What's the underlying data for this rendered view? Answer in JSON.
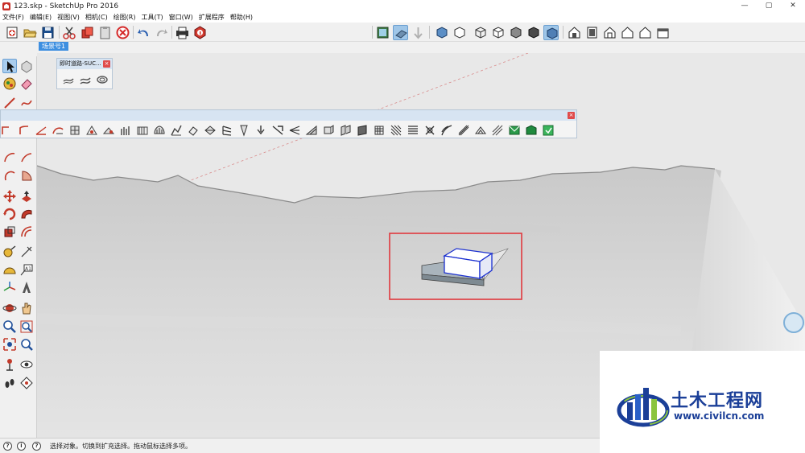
{
  "window": {
    "title": "123.skp - SketchUp Pro 2016",
    "minimize": "—",
    "maximize": "▢",
    "close": "✕"
  },
  "menu": [
    {
      "label": "文件(F)"
    },
    {
      "label": "编辑(E)"
    },
    {
      "label": "视图(V)"
    },
    {
      "label": "相机(C)"
    },
    {
      "label": "绘图(R)"
    },
    {
      "label": "工具(T)"
    },
    {
      "label": "窗口(W)"
    },
    {
      "label": "扩展程序"
    },
    {
      "label": "帮助(H)"
    }
  ],
  "scene": {
    "tab_label": "场景号1"
  },
  "floating_toolbars": {
    "roads": {
      "title": "即时道路-SUC...",
      "close": "×"
    },
    "long": {
      "close": "×"
    }
  },
  "status": {
    "text": "选择对象。切换到扩充选择。拖动鼠标选择多项。",
    "icon_1": "?",
    "icon_2": "i",
    "icon_3": "?"
  },
  "watermark": {
    "brand": "土木工程网",
    "url": "www.civilcn.com"
  },
  "colors": {
    "accent": "#3e8fe0",
    "highlight_box": "#e0393e",
    "selection_blue": "#1a2fd0"
  }
}
